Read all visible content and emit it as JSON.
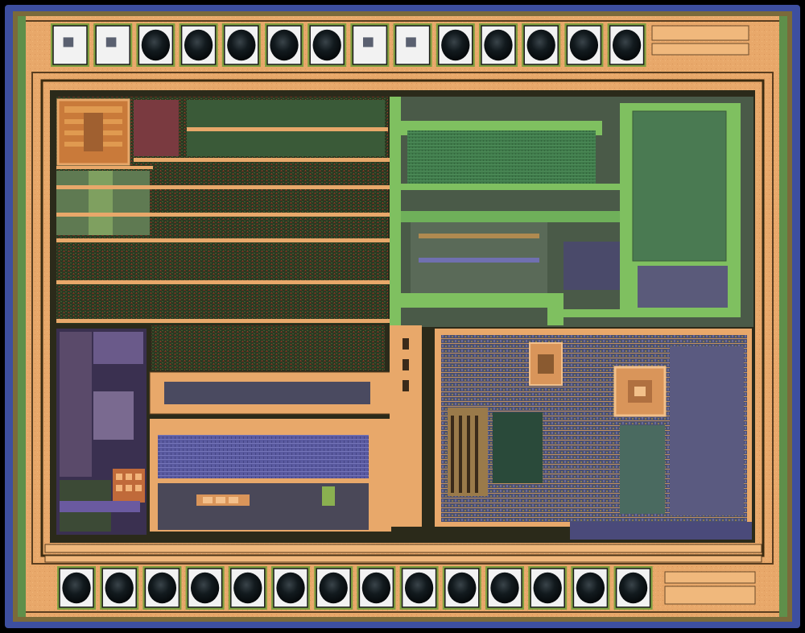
{
  "die": {
    "marking": "",
    "colors": {
      "background": "#000000",
      "seal_ring": "#3d4fa0",
      "metal": "#e8a86a",
      "metal_edge": "#6a4a2a",
      "logic_dark": "#2a3a22",
      "logic_red": "#8a3a2a",
      "green_bus": "#7fc060",
      "memory_green": "#3f7a4a",
      "purple": "#5a5aa0",
      "pad_frame": "#f2f2f2",
      "bump": "#0a0f12"
    },
    "pads": {
      "top_count": 14,
      "bottom_count": 14,
      "top_unbonded": [
        0,
        1,
        7,
        8
      ]
    },
    "regions": [
      {
        "name": "logic-block-left"
      },
      {
        "name": "analog-block-right"
      },
      {
        "name": "memory-array"
      },
      {
        "name": "io-block-lower-left"
      },
      {
        "name": "mixed-signal-lower-right"
      }
    ]
  }
}
